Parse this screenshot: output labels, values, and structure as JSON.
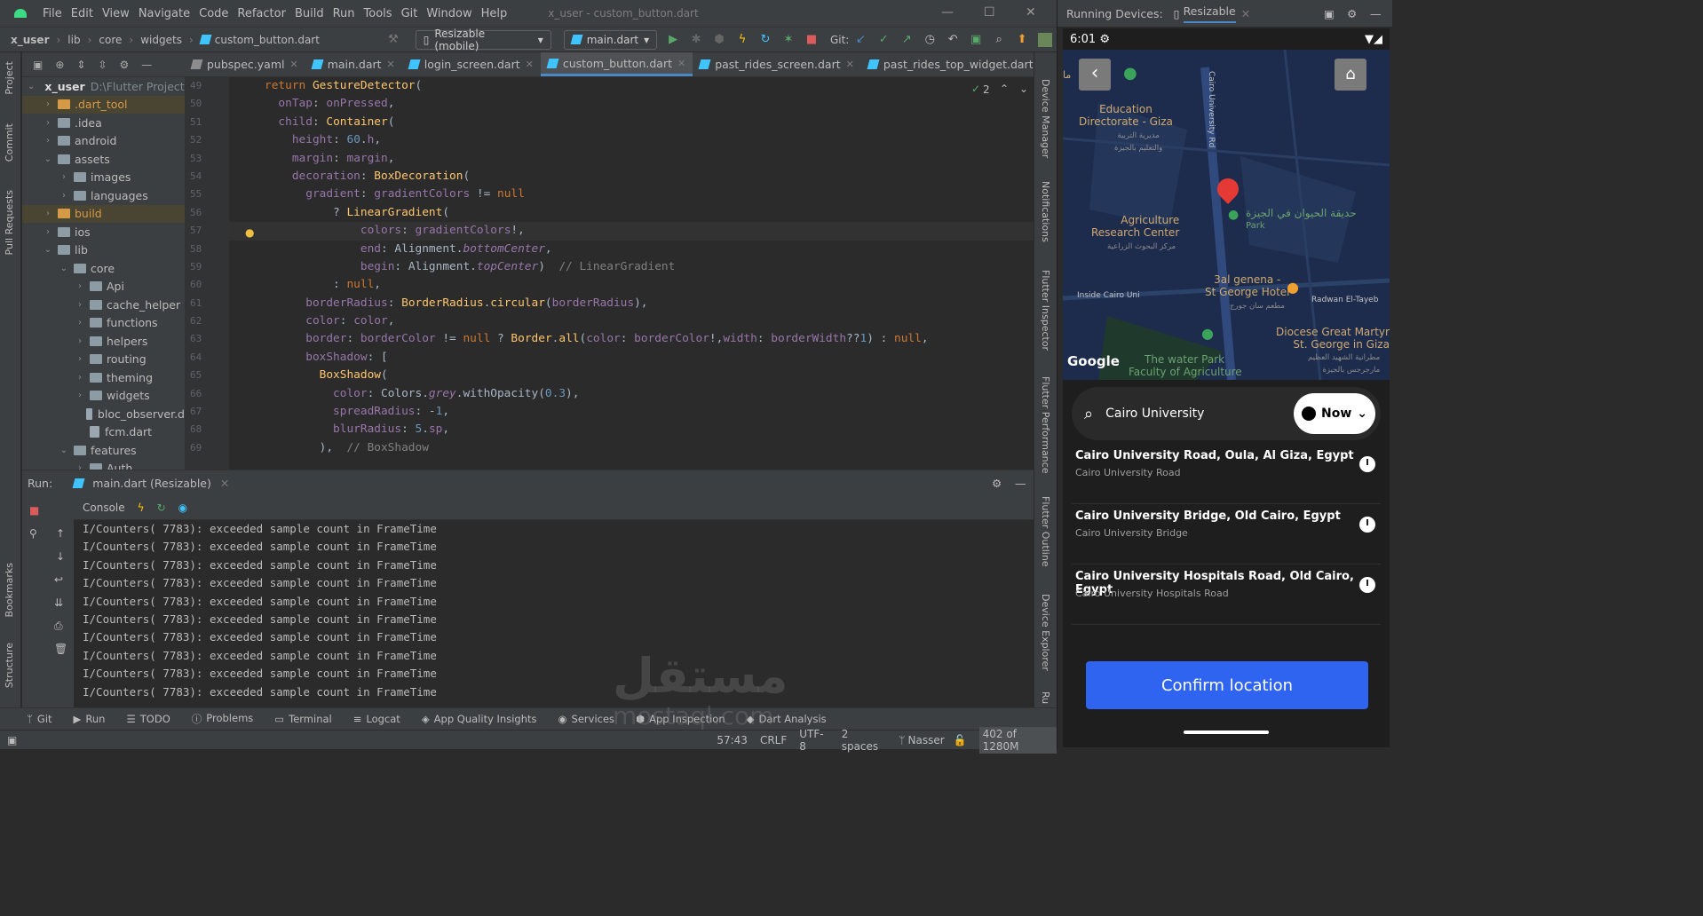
{
  "menu": [
    "File",
    "Edit",
    "View",
    "Navigate",
    "Code",
    "Refactor",
    "Build",
    "Run",
    "Tools",
    "Git",
    "Window",
    "Help"
  ],
  "window_title": "x_user - custom_button.dart",
  "breadcrumbs": [
    "x_user",
    "lib",
    "core",
    "widgets",
    "custom_button.dart"
  ],
  "toolbar": {
    "device": "Resizable (mobile)",
    "run_config": "main.dart",
    "git_label": "Git:"
  },
  "left_strip": [
    "Project",
    "Commit",
    "Pull Requests",
    "Bookmarks",
    "Structure"
  ],
  "right_strip": [
    "Device Manager",
    "Notifications",
    "Flutter Inspector",
    "Flutter Performance",
    "Flutter Outline",
    "Device Explorer",
    "Ru"
  ],
  "project": {
    "root": "x_user",
    "root_path": "D:\\Flutter Projects",
    "items": [
      {
        "label": ".dart_tool",
        "depth": 1,
        "caret": "›",
        "orange": true
      },
      {
        "label": ".idea",
        "depth": 1,
        "caret": "›"
      },
      {
        "label": "android",
        "depth": 1,
        "caret": "›"
      },
      {
        "label": "assets",
        "depth": 1,
        "caret": "⌄"
      },
      {
        "label": "images",
        "depth": 2,
        "caret": "›"
      },
      {
        "label": "languages",
        "depth": 2,
        "caret": "›"
      },
      {
        "label": "build",
        "depth": 1,
        "caret": "›",
        "orange": true
      },
      {
        "label": "ios",
        "depth": 1,
        "caret": "›"
      },
      {
        "label": "lib",
        "depth": 1,
        "caret": "⌄"
      },
      {
        "label": "core",
        "depth": 2,
        "caret": "⌄"
      },
      {
        "label": "Api",
        "depth": 3,
        "caret": "›"
      },
      {
        "label": "cache_helper",
        "depth": 3,
        "caret": "›"
      },
      {
        "label": "functions",
        "depth": 3,
        "caret": "›"
      },
      {
        "label": "helpers",
        "depth": 3,
        "caret": "›"
      },
      {
        "label": "routing",
        "depth": 3,
        "caret": "›"
      },
      {
        "label": "theming",
        "depth": 3,
        "caret": "›"
      },
      {
        "label": "widgets",
        "depth": 3,
        "caret": "›"
      },
      {
        "label": "bloc_observer.d",
        "depth": 3,
        "caret": "",
        "file": true
      },
      {
        "label": "fcm.dart",
        "depth": 3,
        "caret": "",
        "file": true
      },
      {
        "label": "features",
        "depth": 2,
        "caret": "⌄"
      },
      {
        "label": "Auth",
        "depth": 3,
        "caret": "›"
      }
    ]
  },
  "tabs": [
    "pubspec.yaml",
    "main.dart",
    "login_screen.dart",
    "custom_button.dart",
    "past_rides_screen.dart",
    "past_rides_top_widget.dart"
  ],
  "active_tab": 3,
  "inspection_count": "2",
  "line_numbers": [
    "49",
    "50",
    "51",
    "52",
    "53",
    "54",
    "55",
    "56",
    "57",
    "58",
    "59",
    "60",
    "61",
    "62",
    "63",
    "64",
    "65",
    "66",
    "67",
    "68",
    "69"
  ],
  "run": {
    "label": "Run:",
    "config": "main.dart (Resizable)",
    "console": "Console"
  },
  "log_lines": [
    "I/Counters( 7783): exceeded sample count in FrameTime",
    "I/Counters( 7783): exceeded sample count in FrameTime",
    "I/Counters( 7783): exceeded sample count in FrameTime",
    "I/Counters( 7783): exceeded sample count in FrameTime",
    "I/Counters( 7783): exceeded sample count in FrameTime",
    "I/Counters( 7783): exceeded sample count in FrameTime",
    "I/Counters( 7783): exceeded sample count in FrameTime",
    "I/Counters( 7783): exceeded sample count in FrameTime",
    "I/Counters( 7783): exceeded sample count in FrameTime",
    "I/Counters( 7783): exceeded sample count in FrameTime"
  ],
  "bottom_tabs": [
    "Git",
    "Run",
    "TODO",
    "Problems",
    "Terminal",
    "Logcat",
    "App Quality Insights",
    "Services",
    "App Inspection",
    "Dart Analysis"
  ],
  "status": {
    "position": "57:43",
    "eol": "CRLF",
    "encoding": "UTF-8",
    "indent": "2 spaces",
    "user": "Nasser",
    "memory": "402 of 1280M"
  },
  "device_panel": {
    "label": "Running Devices:",
    "tab": "Resizable"
  },
  "phone": {
    "time": "6:01",
    "map_labels": {
      "edu_en": "Education\nDirectorate - Giza",
      "edu_ar": "مديرية التربية\nوالتعليم بالجيزة",
      "road": "Cairo University Rd",
      "zoo_ar": "حديقة الحيوان في الجيزة",
      "park": "Park",
      "agri_en": "Agriculture\nResearch Center",
      "agri_ar": "مركز البحوث الزراعية",
      "food_en": "3al genena -\nSt George Hotel",
      "food_ar": "مطعم سان جورج",
      "inside": "Inside Cairo Uni",
      "radwan": "Radwan El-Tayeb",
      "church_en": "Diocese Great Martyr\nSt. George in Giza",
      "church_ar": "مطرانية الشهيد العظيم\nمارجرجس بالجيزة",
      "water": "The water Park",
      "faculty": "Faculty of Agriculture",
      "google": "Google",
      "left_cut": "ما"
    },
    "search_value": "Cairo University",
    "now_label": "Now",
    "results": [
      {
        "title": "Cairo University Road, Oula, Al Giza, Egypt",
        "sub": "Cairo University Road"
      },
      {
        "title": "Cairo University Bridge, Old Cairo, Egypt",
        "sub": "Cairo University Bridge"
      },
      {
        "title": "Cairo University Hospitals Road, Old Cairo, Egypt",
        "sub": "Cairo University Hospitals Road"
      }
    ],
    "confirm_label": "Confirm location"
  },
  "watermark": {
    "ar": "مستقل",
    "en": "mostaql.com"
  },
  "colors": {
    "accent": "#2f64f0",
    "bg": "#2b2b2b",
    "panel": "#3c3f41",
    "map_bg": "#1d2c4d"
  }
}
